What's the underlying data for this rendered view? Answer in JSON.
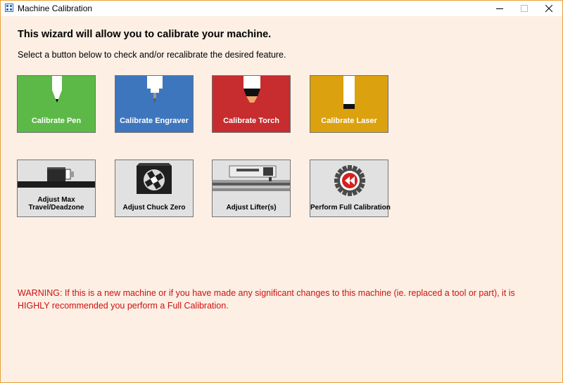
{
  "window": {
    "title": "Machine Calibration",
    "icons": {
      "app": "calibration-app-icon",
      "minimize": "minimize-icon",
      "maximize": "maximize-icon",
      "close": "close-icon"
    },
    "border_color": "#e6a23c",
    "background_color": "#fdefe4"
  },
  "content": {
    "heading": "This wizard will allow you to calibrate your machine.",
    "subheading": "Select a button below to check and/or recalibrate the desired feature.",
    "warning_line1": "WARNING: If this is a new machine or if you have made any significant changes to this machine (ie. replaced a tool or part), it is",
    "warning_line2": "HIGHLY recommended you perform a Full Calibration.",
    "warning_color": "#cc1111"
  },
  "tools": [
    {
      "label": "Calibrate Pen",
      "color": "#5cb947",
      "icon": "pen-tool-icon"
    },
    {
      "label": "Calibrate Engraver",
      "color": "#3e76bd",
      "icon": "engraver-tool-icon"
    },
    {
      "label": "Calibrate Torch",
      "color": "#c72c2e",
      "icon": "torch-tool-icon"
    },
    {
      "label": "Calibrate Laser",
      "color": "#dca10e",
      "icon": "laser-tool-icon"
    }
  ],
  "adjustments": [
    {
      "label_line1": "Adjust Max",
      "label_line2": "Travel/Deadzone",
      "icon": "max-travel-icon"
    },
    {
      "label": "Adjust Chuck Zero",
      "icon": "chuck-icon"
    },
    {
      "label": "Adjust Lifter(s)",
      "icon": "lifter-icon"
    },
    {
      "label": "Perform Full Calibration",
      "icon": "rewind-gear-icon"
    }
  ]
}
